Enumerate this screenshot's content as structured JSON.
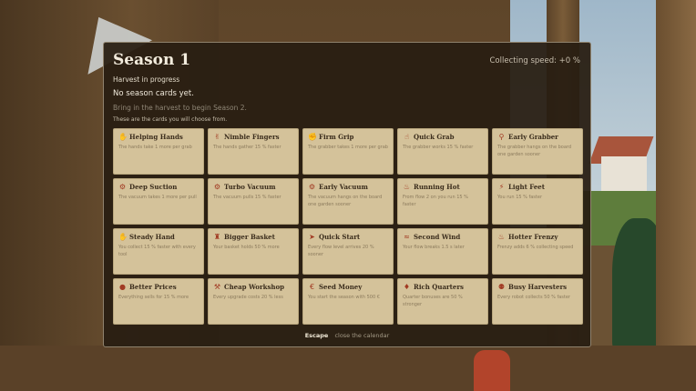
{
  "calendar": {
    "title": "Season 1",
    "collecting_speed": "Collecting speed: +0 %",
    "status": "Harvest in progress",
    "no_cards": "No season cards yet.",
    "hint": "Bring in the harvest to begin Season 2.",
    "choose_text": "These are the cards you will choose from.",
    "cards": [
      {
        "name": "Helping Hands",
        "desc": "The hands take 1 more per grab",
        "icon": "hand-icon"
      },
      {
        "name": "Nimble Fingers",
        "desc": "The hands gather 15 % faster",
        "icon": "fingers-icon"
      },
      {
        "name": "Firm Grip",
        "desc": "The grabber takes 1 more per grab",
        "icon": "grip-icon"
      },
      {
        "name": "Quick Grab",
        "desc": "The grabber works 15 % faster",
        "icon": "grab-icon"
      },
      {
        "name": "Early Grabber",
        "desc": "The grabber hangs on the board one garden sooner",
        "icon": "grabber-icon"
      },
      {
        "name": "Deep Suction",
        "desc": "The vacuum takes 1 more per pull",
        "icon": "suction-icon"
      },
      {
        "name": "Turbo Vacuum",
        "desc": "The vacuum pulls 15 % faster",
        "icon": "vacuum-icon"
      },
      {
        "name": "Early Vacuum",
        "desc": "The vacuum hangs on the board one garden sooner",
        "icon": "vacuum-icon"
      },
      {
        "name": "Running Hot",
        "desc": "From flow 2 on you run 15 % faster",
        "icon": "flame-icon"
      },
      {
        "name": "Light Feet",
        "desc": "You run 15 % faster",
        "icon": "feet-icon"
      },
      {
        "name": "Steady Hand",
        "desc": "You collect 15 % faster with every tool",
        "icon": "hand-icon"
      },
      {
        "name": "Bigger Basket",
        "desc": "Your basket holds 50 % more",
        "icon": "basket-icon"
      },
      {
        "name": "Quick Start",
        "desc": "Every flow level arrives 20 % sooner",
        "icon": "start-icon"
      },
      {
        "name": "Second Wind",
        "desc": "Your flow breaks 1.5 s later",
        "icon": "wind-icon"
      },
      {
        "name": "Hotter Frenzy",
        "desc": "Frenzy adds 6 % collecting speed",
        "icon": "flame-icon"
      },
      {
        "name": "Better Prices",
        "desc": "Everything sells for 15 % more",
        "icon": "coin-icon"
      },
      {
        "name": "Cheap Workshop",
        "desc": "Every upgrade costs 20 % less",
        "icon": "hammer-icon"
      },
      {
        "name": "Seed Money",
        "desc": "You start the season with 500 €",
        "icon": "money-icon"
      },
      {
        "name": "Rich Quarters",
        "desc": "Quarter bonuses are 50 % stronger",
        "icon": "quarters-icon"
      },
      {
        "name": "Busy Harvesters",
        "desc": "Every robot collects 50 % faster",
        "icon": "robot-icon"
      }
    ],
    "footer": {
      "key": "Escape",
      "label": "close the calendar"
    }
  },
  "colors": {
    "panel_bg": "#281e12",
    "card_bg": "#d4c29a",
    "card_title": "#3a2c1c",
    "icon_accent": "#a13a23"
  }
}
